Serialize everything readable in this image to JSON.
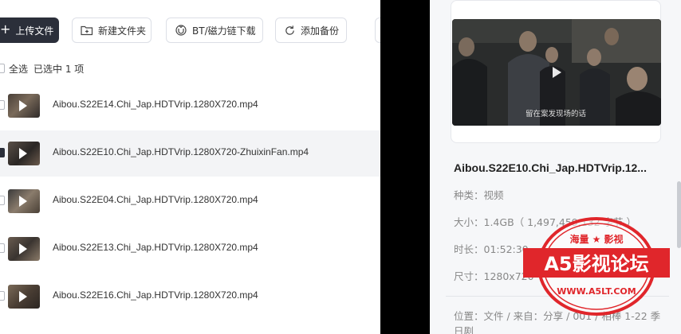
{
  "toolbar": {
    "upload_label": "上传文件",
    "new_folder_label": "新建文件夹",
    "bt_label": "BT/磁力链下载",
    "backup_label": "添加备份"
  },
  "selection": {
    "select_all_label": "全选",
    "selected_text": "已选中  1  项"
  },
  "files": [
    {
      "name": "Aibou.S22E14.Chi_Jap.HDTVrip.1280X720.mp4",
      "selected": false
    },
    {
      "name": "Aibou.S22E10.Chi_Jap.HDTVrip.1280X720-ZhuixinFan.mp4",
      "selected": true
    },
    {
      "name": "Aibou.S22E04.Chi_Jap.HDTVrip.1280X720.mp4",
      "selected": false
    },
    {
      "name": "Aibou.S22E13.Chi_Jap.HDTVrip.1280X720.mp4",
      "selected": false
    },
    {
      "name": "Aibou.S22E16.Chi_Jap.HDTVrip.1280X720.mp4",
      "selected": false
    }
  ],
  "detail": {
    "title": "Aibou.S22E10.Chi_Jap.HDTVrip.12...",
    "preview_subtitle": "留在案发现场的话",
    "type_line": "种类：视频",
    "size_line": "大小：1.4GB（ 1,497,459,132 字节 ）",
    "duration_line": "时长：01:52:30",
    "dimension_line": "尺寸：1280x720",
    "location_line": "位置：文件 / 来自：分享 / 001 / 相棒 1-22 季 日剧"
  },
  "watermark": {
    "top_text": "海量 ★ 影视",
    "main_text": "A5影视论坛",
    "url_text": "WWW.A5LT.COM"
  },
  "colors": {
    "dark_button": "#2b2f3a",
    "selected_row": "#f3f4f6",
    "panel_bg": "#f6f7f9",
    "stamp_red": "#e0262b"
  }
}
